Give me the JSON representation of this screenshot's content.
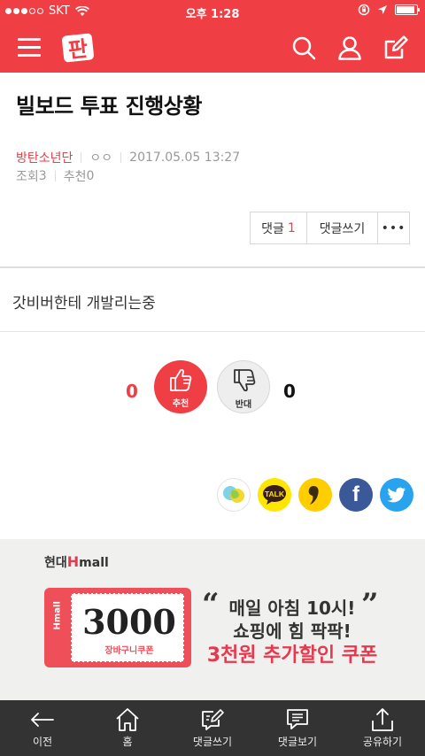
{
  "status_bar": {
    "carrier": "SKT",
    "time": "오후 1:28",
    "battery": 0.9
  },
  "header": {
    "logo_text": "판",
    "icons": [
      "menu-icon",
      "search-icon",
      "user-icon",
      "edit-icon"
    ]
  },
  "post": {
    "title": "빌보드 투표 진행상황",
    "author": "방탄소년단",
    "author_extra": "ㅇㅇ",
    "datetime": "2017.05.05 13:27",
    "views_label": "조회",
    "views": "3",
    "recommend_label": "추천",
    "recommend": "0",
    "comment_label": "댓글",
    "comment_count": "1",
    "write_comment_label": "댓글쓰기",
    "more_label": "•••",
    "content": "갓비버한테 개발리는중"
  },
  "votes": {
    "up_count": "0",
    "up_label": "추천",
    "down_count": "0",
    "down_label": "반대"
  },
  "share": {
    "icons": [
      "share-general-icon",
      "kakaotalk-icon",
      "kakaostory-icon",
      "facebook-icon",
      "twitter-icon"
    ],
    "talk_text": "TALK",
    "facebook_text": "f"
  },
  "ad": {
    "brand_prefix": "현대",
    "brand_h": "H",
    "brand_suffix": "mall",
    "coupon_side": "Hmall",
    "coupon_amount": "3000",
    "coupon_sub": "장바구니쿠폰",
    "line1": "매일 아침 10시!",
    "line2": "쇼핑에 힘 팍팍!",
    "line3": "3천원 추가할인 쿠폰",
    "accent_color": "#e8384e"
  },
  "toolbar": {
    "items": [
      {
        "label": "이전",
        "icon": "back-arrow-icon"
      },
      {
        "label": "홈",
        "icon": "home-icon"
      },
      {
        "label": "댓글쓰기",
        "icon": "write-comment-icon"
      },
      {
        "label": "댓글보기",
        "icon": "view-comments-icon"
      },
      {
        "label": "공유하기",
        "icon": "share-icon"
      }
    ]
  },
  "colors": {
    "brand": "#ef3e44",
    "toolbar": "#333333"
  }
}
